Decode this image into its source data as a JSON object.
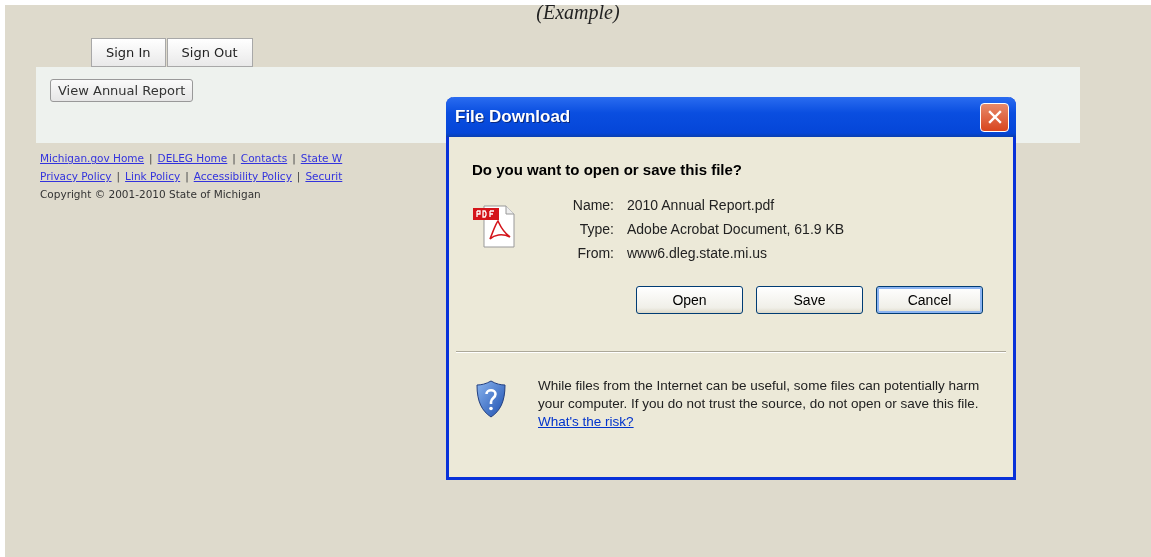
{
  "page_caption": "(Example)",
  "auth_buttons": [
    {
      "label": "Sign In"
    },
    {
      "label": "Sign Out"
    }
  ],
  "view_button": {
    "label": "View Annual Report"
  },
  "footer": {
    "rows": [
      {
        "links": [
          "Michigan.gov Home",
          "DELEG Home",
          "Contacts",
          "State W"
        ]
      },
      {
        "links": [
          "Privacy Policy",
          "Link Policy",
          "Accessibility Policy",
          "Securit"
        ]
      }
    ],
    "separator": "|",
    "copyright": "Copyright © 2001-2010 State of Michigan"
  },
  "dialog": {
    "title": "File Download",
    "question": "Do you want to open or save this file?",
    "fields": [
      {
        "label": "Name:",
        "value": "2010 Annual Report.pdf"
      },
      {
        "label": "Type:",
        "value": "Adobe Acrobat Document, 61.9 KB"
      },
      {
        "label": "From:",
        "value": "www6.dleg.state.mi.us"
      }
    ],
    "buttons": [
      {
        "label": "Open",
        "focused": false
      },
      {
        "label": "Save",
        "focused": false
      },
      {
        "label": "Cancel",
        "focused": true
      }
    ],
    "warning": {
      "text": "While files from the Internet can be useful, some files can potentially harm your computer. If you do not trust the source, do not open or save this file.",
      "link": "What's the risk?"
    }
  }
}
